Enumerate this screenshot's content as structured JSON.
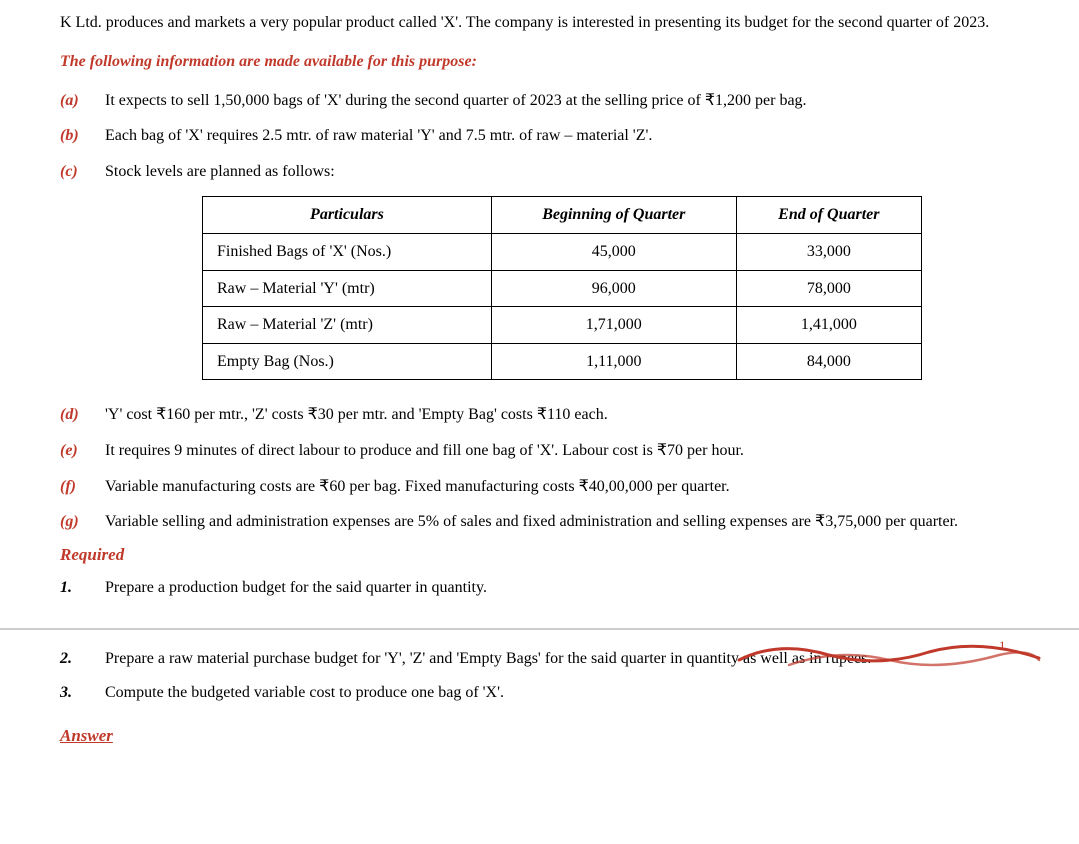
{
  "intro": {
    "text": "K Ltd. produces and markets a very popular product called 'X'. The company is interested in presenting its budget for the second quarter of 2023."
  },
  "heading": {
    "text": "The following information are made available for this purpose:"
  },
  "items": [
    {
      "label": "(a)",
      "text": "It expects to sell 1,50,000 bags of 'X' during the second quarter of 2023 at the selling price of ₹1,200 per bag."
    },
    {
      "label": "(b)",
      "text": "Each bag of 'X' requires 2.5 mtr. of raw material 'Y' and 7.5 mtr. of raw – material 'Z'."
    },
    {
      "label": "(c)",
      "text": "Stock levels are planned as follows:"
    },
    {
      "label": "(d)",
      "text": "'Y' cost ₹160 per mtr., 'Z' costs ₹30 per mtr. and 'Empty Bag' costs ₹110 each."
    },
    {
      "label": "(e)",
      "text": "It requires 9 minutes of direct labour to produce and fill one bag of 'X'. Labour cost is ₹70 per hour."
    },
    {
      "label": "(f)",
      "text": "Variable manufacturing costs are ₹60 per bag. Fixed manufacturing costs ₹40,00,000 per quarter."
    },
    {
      "label": "(g)",
      "text": "Variable selling and administration expenses are 5% of sales and fixed administration and selling expenses are ₹3,75,000 per quarter."
    }
  ],
  "table": {
    "headers": [
      "Particulars",
      "Beginning of Quarter",
      "End of Quarter"
    ],
    "rows": [
      [
        "Finished Bags of 'X' (Nos.)",
        "45,000",
        "33,000"
      ],
      [
        "Raw – Material 'Y' (mtr)",
        "96,000",
        "78,000"
      ],
      [
        "Raw – Material 'Z' (mtr)",
        "1,71,000",
        "1,41,000"
      ],
      [
        "Empty Bag (Nos.)",
        "1,11,000",
        "84,000"
      ]
    ]
  },
  "required": {
    "heading": "Required"
  },
  "questions": [
    {
      "label": "1.",
      "text": "Prepare a production budget for the said quarter in quantity."
    },
    {
      "label": "2.",
      "text": "Prepare a raw material purchase budget for 'Y', 'Z' and 'Empty Bags' for the said quarter in quantity as well as in rupees."
    },
    {
      "label": "3.",
      "text": "Compute the budgeted variable cost to produce one bag of 'X'."
    }
  ],
  "answer": {
    "heading": "Answer"
  }
}
